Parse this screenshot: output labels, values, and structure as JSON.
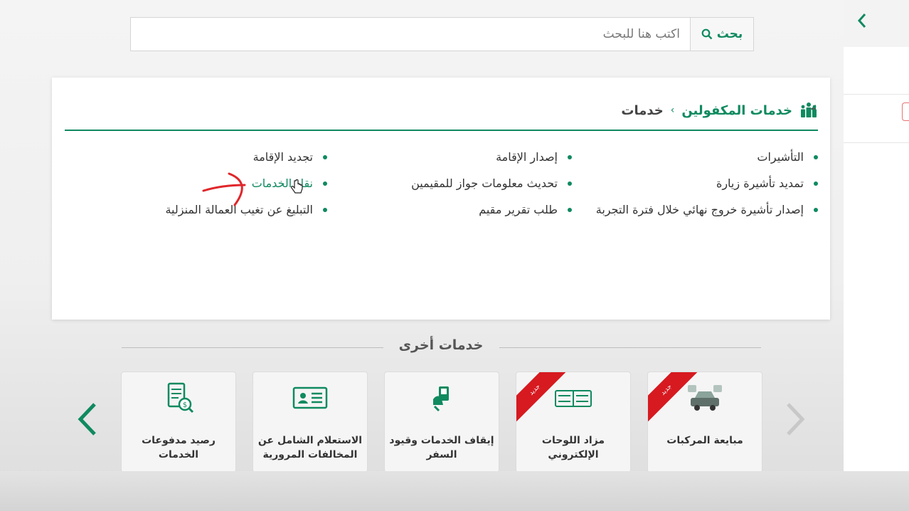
{
  "search": {
    "button_label": "بحث",
    "placeholder": "اكتب هنا للبحث"
  },
  "breadcrumb": {
    "main": "خدمات المكفولين",
    "separator": "›",
    "current": "خدمات"
  },
  "services": {
    "col1": [
      "التأشيرات",
      "تمديد تأشيرة زيارة",
      "إصدار تأشيرة خروج نهائي خلال فترة التجربة"
    ],
    "col2": [
      "إصدار الإقامة",
      "تحديث معلومات جواز للمقيمين",
      "طلب تقرير مقيم"
    ],
    "col3": [
      "تجديد الإقامة",
      "نقل الخدمات",
      "التبليغ عن تغيب العمالة المنزلية"
    ]
  },
  "other_services": {
    "title": "خدمات أخرى",
    "tiles": [
      {
        "label": "مبايعة المركبات",
        "badge": "جديد",
        "icon": "car-sale-icon"
      },
      {
        "label": "مزاد اللوحات الإلكتروني",
        "badge": "جديد",
        "icon": "plates-auction-icon"
      },
      {
        "label": "إيقاف الخدمات وقيود السفر",
        "badge": "",
        "icon": "suspend-services-icon"
      },
      {
        "label": "الاستعلام الشامل عن المخالفات المرورية",
        "badge": "",
        "icon": "id-card-icon"
      },
      {
        "label": "رصيد مدفوعات الخدمات",
        "badge": "",
        "icon": "payment-balance-icon"
      }
    ]
  },
  "colors": {
    "accent": "#0f8a5f",
    "badge": "#d71920"
  }
}
